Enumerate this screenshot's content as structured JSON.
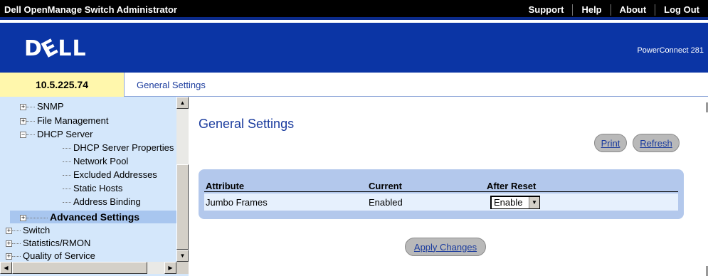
{
  "app": {
    "title": "Dell OpenManage Switch Administrator",
    "links": [
      "Support",
      "Help",
      "About",
      "Log Out"
    ],
    "logo": "DELL",
    "model": "PowerConnect 281"
  },
  "infobar": {
    "ip": "10.5.225.74",
    "breadcrumb": "General Settings"
  },
  "tree": {
    "items": [
      {
        "label": "SNMP",
        "expander": "+"
      },
      {
        "label": "File Management",
        "expander": "+"
      },
      {
        "label": "DHCP Server",
        "expander": "−"
      },
      {
        "label": "DHCP Server Properties"
      },
      {
        "label": "Network Pool"
      },
      {
        "label": "Excluded Addresses"
      },
      {
        "label": "Static Hosts"
      },
      {
        "label": "Address Binding"
      },
      {
        "label": "Advanced Settings",
        "expander": "+",
        "selected": true
      },
      {
        "label": "Switch",
        "expander": "+"
      },
      {
        "label": "Statistics/RMON",
        "expander": "+"
      },
      {
        "label": "Quality of Service",
        "expander": "+"
      }
    ]
  },
  "main": {
    "title": "General Settings",
    "print_label": "Print",
    "refresh_label": "Refresh",
    "table": {
      "headers": [
        "Attribute",
        "Current",
        "After Reset"
      ],
      "rows": [
        {
          "attribute": "Jumbo Frames",
          "current": "Enabled",
          "after_reset": "Enable"
        }
      ]
    },
    "apply_label": "Apply Changes"
  },
  "colors": {
    "header_blue": "#0b35a5",
    "ip_box": "#fff7ac",
    "tree_bg": "#d4e7fb",
    "panel_bg": "#b3c8ec",
    "link_blue": "#1b3c9e"
  }
}
